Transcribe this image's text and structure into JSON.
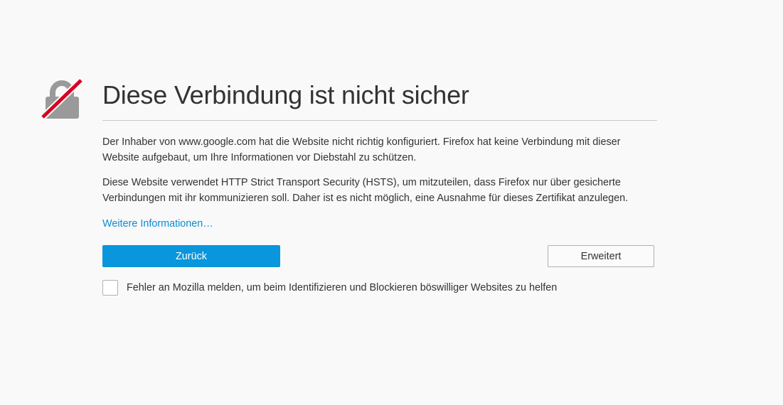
{
  "error": {
    "title": "Diese Verbindung ist nicht sicher",
    "paragraph1": "Der Inhaber von www.google.com hat die Website nicht richtig konfiguriert. Firefox hat keine Verbindung mit dieser Website aufgebaut, um Ihre Informationen vor Diebstahl zu schützen.",
    "paragraph2": "Diese Website verwendet HTTP Strict Transport Security (HSTS), um mitzuteilen, dass Firefox nur über gesicherte Verbindungen mit ihr kommunizieren soll. Daher ist es nicht möglich, eine Ausnahme für dieses Zertifikat anzulegen.",
    "learn_more": "Weitere Informationen…",
    "icon": "insecure-lock-icon"
  },
  "buttons": {
    "back_label": "Zurück",
    "advanced_label": "Erweitert"
  },
  "report": {
    "checked": false,
    "label": "Fehler an Mozilla melden, um beim Identifizieren und Blockieren böswilliger Websites zu helfen"
  },
  "colors": {
    "background": "#f9f9fa",
    "primary_button": "#0996dc",
    "link": "#0a8dd6",
    "strike": "#d70022",
    "lock": "#9a9a9a"
  }
}
